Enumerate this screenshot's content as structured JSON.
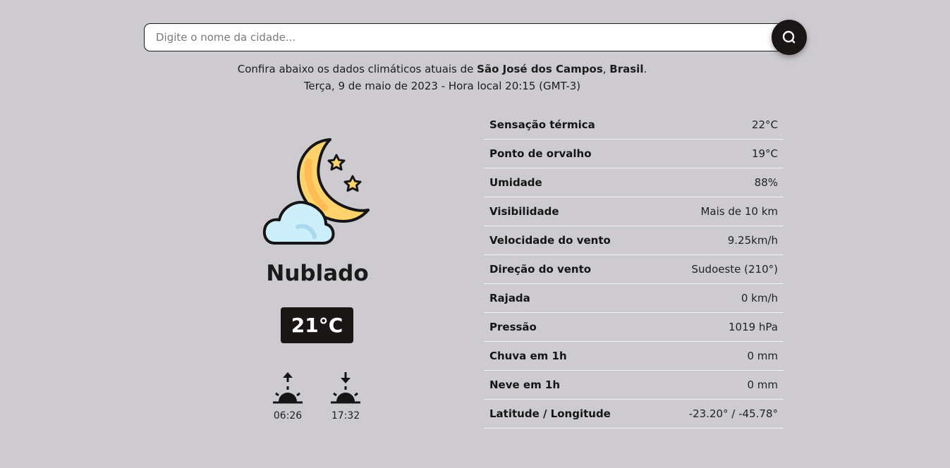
{
  "search": {
    "placeholder": "Digite o nome da cidade...",
    "value": "",
    "icon": "search-icon"
  },
  "info": {
    "line1_prefix": "Confira abaixo os dados climáticos atuais de ",
    "city": "São José dos Campos",
    "separator": ", ",
    "country": "Brasil",
    "line1_suffix": ".",
    "line2": "Terça, 9 de maio de 2023 - Hora local 20:15 (GMT-3)"
  },
  "current": {
    "icon": "moon-stars-cloud-icon",
    "condition": "Nublado",
    "temperature": "21°C",
    "sunrise": "06:26",
    "sunset": "17:32"
  },
  "details": [
    {
      "label": "Sensação térmica",
      "value": "22°C"
    },
    {
      "label": "Ponto de orvalho",
      "value": "19°C"
    },
    {
      "label": "Umidade",
      "value": "88%"
    },
    {
      "label": "Visibilidade",
      "value": "Mais de 10 km"
    },
    {
      "label": "Velocidade do vento",
      "value": "9.25km/h"
    },
    {
      "label": "Direção do vento",
      "value": "Sudoeste (210°)"
    },
    {
      "label": "Rajada",
      "value": "0 km/h"
    },
    {
      "label": "Pressão",
      "value": "1019 hPa"
    },
    {
      "label": "Chuva em 1h",
      "value": "0 mm"
    },
    {
      "label": "Neve em 1h",
      "value": "0 mm"
    },
    {
      "label": "Latitude / Longitude",
      "value": "-23.20° / -45.78°"
    }
  ],
  "colors": {
    "background": "#cdcbd0",
    "dark": "#1a1616",
    "moon": "#ffd36b",
    "cloud": "#cdeefb"
  }
}
